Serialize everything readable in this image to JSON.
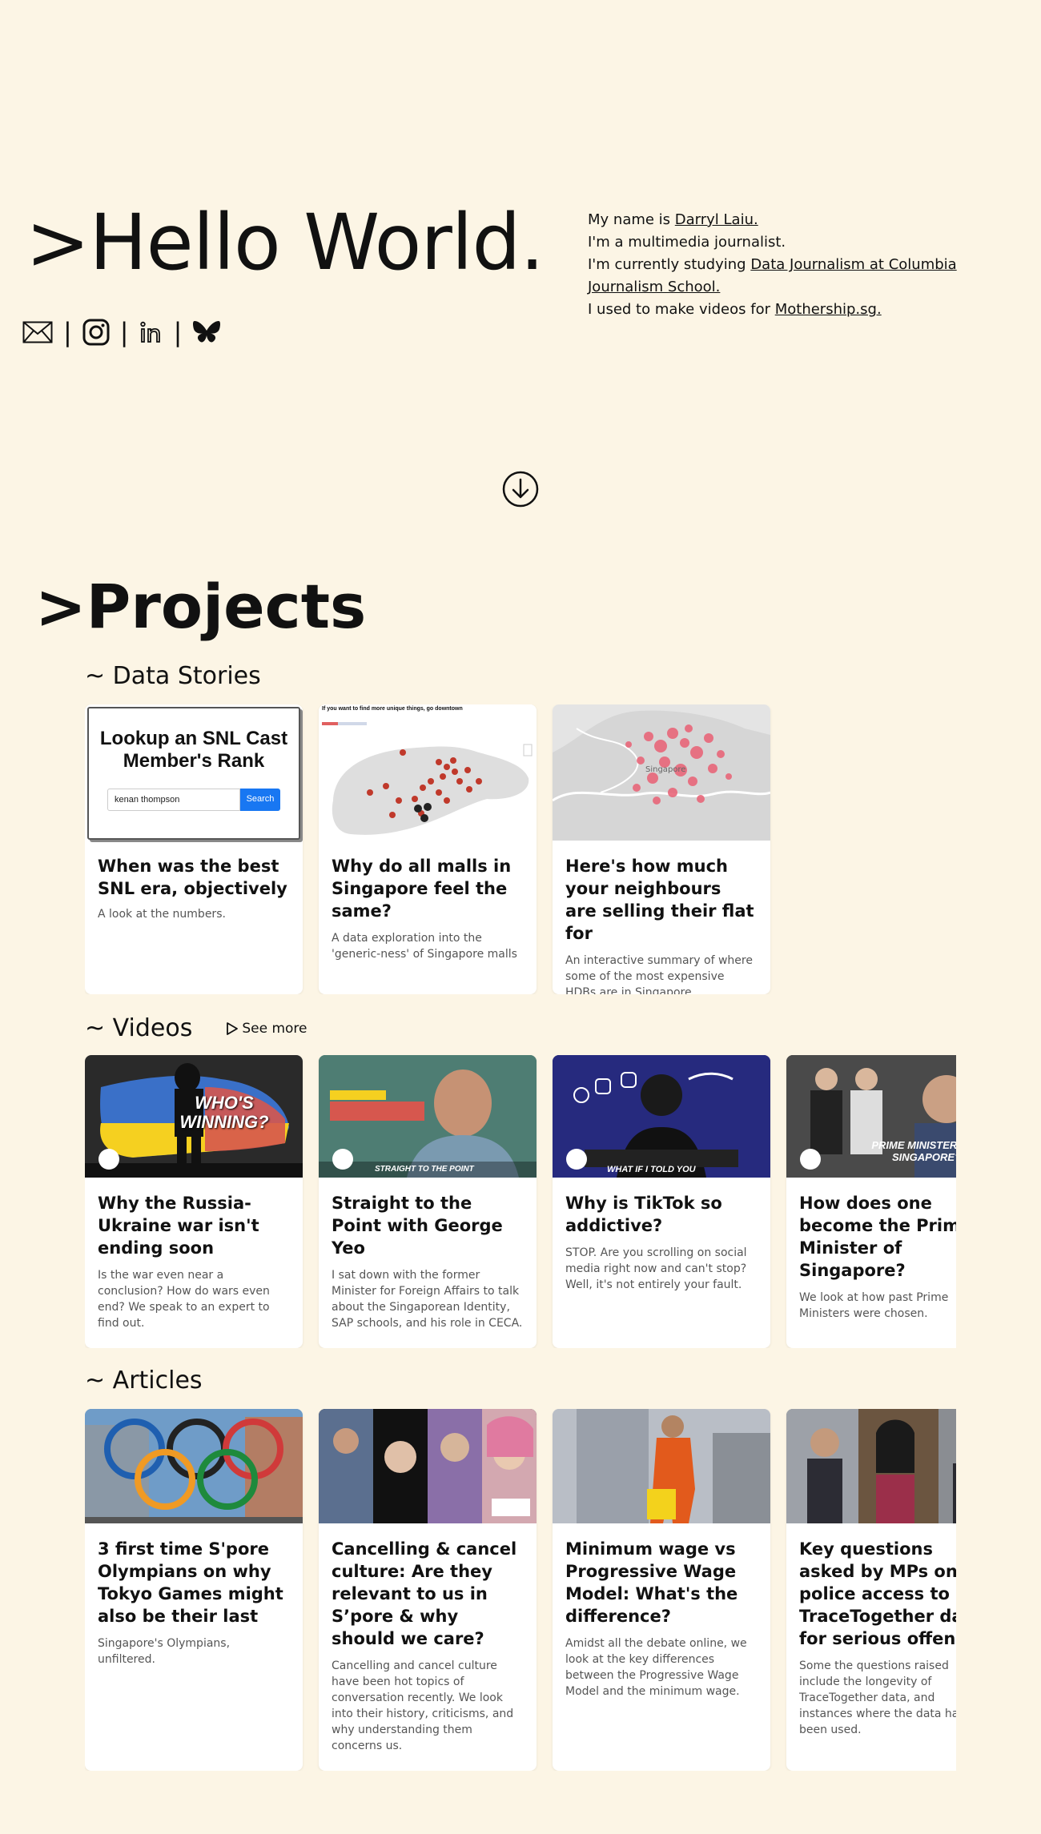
{
  "hero": {
    "title": ">Hello World.",
    "bio": {
      "line1_prefix": "My name is ",
      "line1_link": "Darryl Laiu.",
      "line2": "I'm a multimedia journalist.",
      "line3_prefix": "I'm currently studying ",
      "line3_link": "Data Journalism at Columbia Journalism School.",
      "line4_prefix": "I used to make videos for ",
      "line4_link": "Mothership.sg."
    },
    "socials": [
      "mail-icon",
      "instagram-icon",
      "linkedin-icon",
      "bluesky-icon"
    ],
    "separator": "|"
  },
  "projects": {
    "title": ">Projects",
    "data_stories": {
      "heading": "~ Data Stories",
      "cards": [
        {
          "title": "When was the best SNL era, objectively",
          "desc": "A look at the numbers.",
          "thumb": {
            "heading": "Lookup an SNL Cast Member's Rank",
            "input_value": "kenan thompson",
            "button": "Search"
          }
        },
        {
          "title": "Why do all malls in Singapore feel the same?",
          "desc": "A data exploration into the 'generic-ness' of Singapore malls",
          "thumb": {
            "caption": "If you want to find more unique things, go downtown"
          }
        },
        {
          "title": "Here's how much your neighbours are selling their flat for",
          "desc": "An interactive summary of where some of the most expensive HDBs are in Singapore.",
          "thumb": {
            "label": "Singapore"
          }
        }
      ]
    },
    "videos": {
      "heading": "~ Videos",
      "see_more": "See more",
      "cards": [
        {
          "title": "Why the Russia-Ukraine war isn't ending soon",
          "desc": "Is the war even near a conclusion? How do wars even end? We speak to an expert to find out.",
          "thumb_text": "WHO'S WINNING?"
        },
        {
          "title": "Straight to the Point with George Yeo",
          "desc": "I sat down with the former Minister for Foreign Affairs to talk about the Singaporean Identity, SAP schools, and his role in CECA.",
          "thumb_text": "STRAIGHT TO THE POINT"
        },
        {
          "title": "Why is TikTok so addictive?",
          "desc": "STOP. Are you scrolling on social media right now and can't stop? Well, it's not entirely your fault.",
          "thumb_text": "WHAT IF I TOLD YOU"
        },
        {
          "title": "How does one become the Prime Minister of Singapore?",
          "desc": "We look at how past Prime Ministers were chosen.",
          "thumb_text": "PRIME MINISTERS OF SINGAPORE?"
        }
      ]
    },
    "articles": {
      "heading": "~ Articles",
      "cards": [
        {
          "title": "3 first time S'pore Olympians on why Tokyo Games might also be their last",
          "desc": "Singapore's Olympians, unfiltered."
        },
        {
          "title": "Cancelling & cancel culture: Are they relevant to us in S’pore & why should we care?",
          "desc": "Cancelling and cancel culture have been hot topics of conversation recently. We look into their history, criticisms, and why understanding them concerns us."
        },
        {
          "title": "Minimum wage vs Progressive Wage Model: What's the difference?",
          "desc": "Amidst all the debate online, we look at the key differences between the Progressive Wage Model and the minimum wage."
        },
        {
          "title": "Key questions asked by MPs on police access to TraceTogether data for serious offences",
          "desc": "Some the questions raised include the longevity of TraceTogether data, and instances where the data has been used."
        }
      ]
    }
  }
}
